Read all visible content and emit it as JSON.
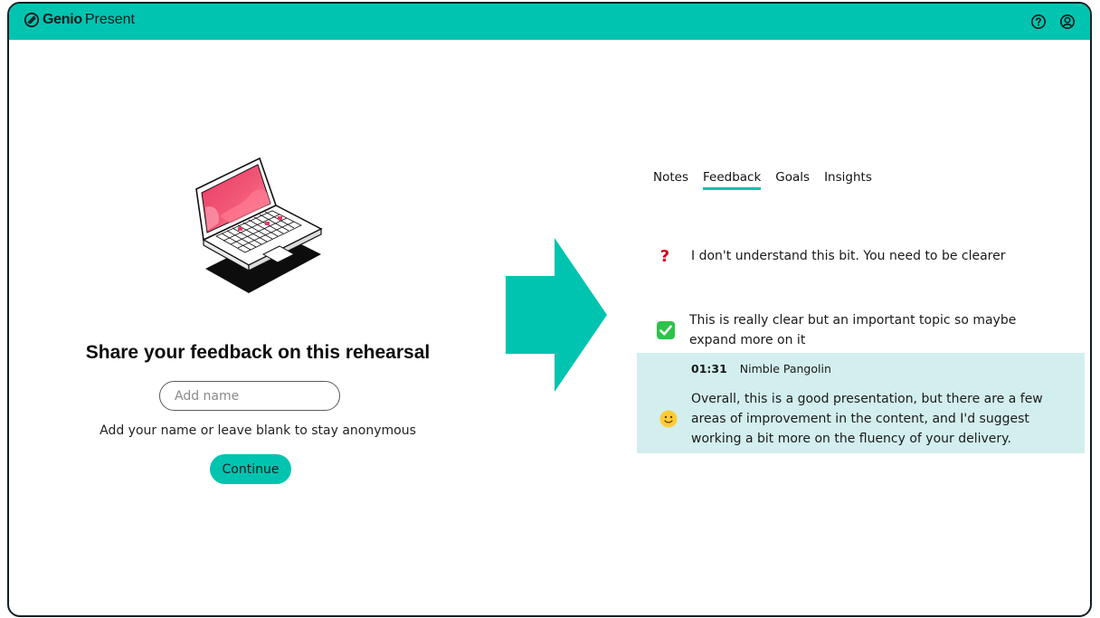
{
  "app": {
    "brand_bold": "Genio",
    "brand_light": "Present"
  },
  "header": {
    "icons": [
      "help-icon",
      "account-icon"
    ]
  },
  "share": {
    "title": "Share your feedback on this rehearsal",
    "name_placeholder": "Add name",
    "name_value": "",
    "hint": "Add your name or leave blank to stay anonymous",
    "continue_label": "Continue"
  },
  "tabs": [
    {
      "label": "Notes",
      "active": false
    },
    {
      "label": "Feedback",
      "active": true
    },
    {
      "label": "Goals",
      "active": false
    },
    {
      "label": "Insights",
      "active": false
    }
  ],
  "feedback": [
    {
      "icon": "question-mark-icon",
      "symbol": "?",
      "text": "I don't understand this bit. You need to be clearer"
    },
    {
      "icon": "check-mark-icon",
      "text": "This is really clear but an important topic so maybe expand more on it"
    }
  ],
  "highlighted_comment": {
    "time": "01:31",
    "author": "Nimble Pangolin",
    "icon": "smiley-face-icon",
    "text": "Overall, this is a good presentation, but there are a few areas of improvement in the content, and I'd suggest working a bit more on the fluency of your delivery."
  },
  "colors": {
    "accent": "#00c4b0",
    "highlight": "#d3eeee",
    "question": "#d0021b",
    "check": "#2ec24a"
  }
}
